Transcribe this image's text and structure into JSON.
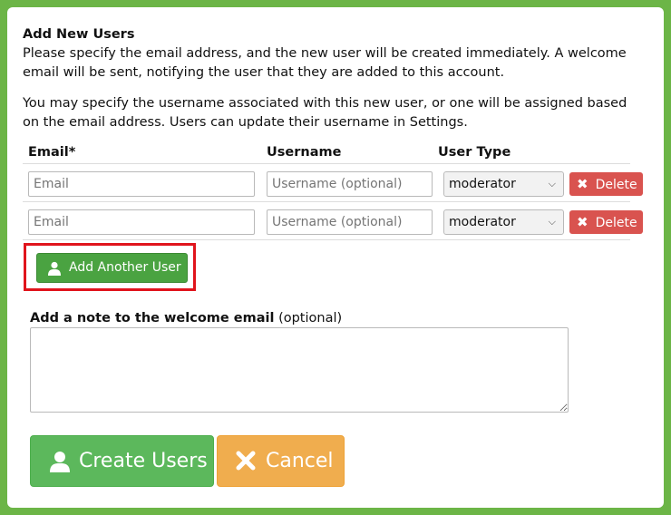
{
  "form": {
    "title": "Add New Users",
    "intro": "Please specify the email address, and the new user will be created immediately. A welcome email will be sent, notifying the user that they are added to this account.",
    "username_info": "You may specify the username associated with this new user, or one will be assigned based on the email address. Users can update their username in Settings."
  },
  "table": {
    "headers": {
      "email": "Email*",
      "username": "Username",
      "user_type": "User Type"
    },
    "rows": [
      {
        "email_placeholder": "Email",
        "username_placeholder": "Username (optional)",
        "user_type": "moderator",
        "delete_label": "Delete"
      },
      {
        "email_placeholder": "Email",
        "username_placeholder": "Username (optional)",
        "user_type": "moderator",
        "delete_label": "Delete"
      }
    ]
  },
  "add_user_button": {
    "label": "Add Another User",
    "icon": "user-icon"
  },
  "note": {
    "label_bold": "Add a note to the welcome email",
    "label_optional": "(optional)"
  },
  "actions": {
    "create_label": "Create Users",
    "cancel_label": "Cancel"
  },
  "colors": {
    "frame": "#6cb547",
    "create": "#5cb85c",
    "cancel": "#f0ad4e",
    "delete": "#d9534f",
    "add_user": "#4aa341",
    "highlight": "#e0141c"
  }
}
